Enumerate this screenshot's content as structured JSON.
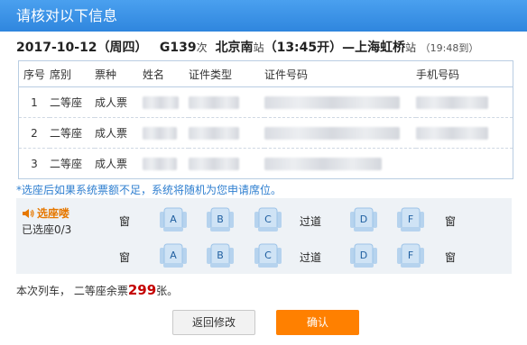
{
  "window": {
    "title": "请核对以下信息"
  },
  "trip": {
    "date": "2017-10-12",
    "weekday": "（周四）",
    "train_no": "G139",
    "train_suffix": "次",
    "from_station": "北京南",
    "from_suffix": "站",
    "depart": "（13:45开）",
    "dash": "—",
    "to_station": "上海虹桥",
    "to_suffix": "站",
    "arrive": "（19:48到）"
  },
  "table": {
    "headers": [
      "序号",
      "席别",
      "票种",
      "姓名",
      "证件类型",
      "证件号码",
      "手机号码"
    ],
    "rows": [
      {
        "no": "1",
        "seat_class": "二等座",
        "ticket_type": "成人票"
      },
      {
        "no": "2",
        "seat_class": "二等座",
        "ticket_type": "成人票"
      },
      {
        "no": "3",
        "seat_class": "二等座",
        "ticket_type": "成人票"
      }
    ]
  },
  "notice": "*选座后如果系统票额不足，系统将随机为您申请席位。",
  "seat_select": {
    "title": "选座喽",
    "selected": "已选座0/3",
    "window_label": "窗",
    "aisle_label": "过道",
    "seats": [
      "A",
      "B",
      "C",
      "D",
      "F"
    ],
    "icon": "speaker-icon"
  },
  "remaining": {
    "prefix": "本次列车，  二等座余票",
    "count": "299",
    "suffix": "张。"
  },
  "buttons": {
    "back": "返回修改",
    "confirm": "确认"
  },
  "colors": {
    "title_bar": "#3a8ee6",
    "confirm": "#ff8000",
    "count": "#c40000",
    "notice": "#2f7fd0"
  }
}
